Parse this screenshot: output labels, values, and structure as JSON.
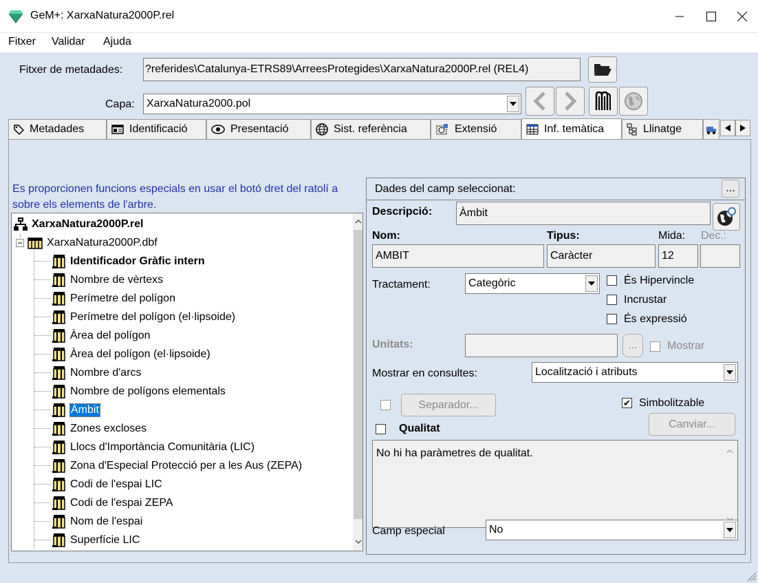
{
  "window": {
    "title": "GeM+: XarxaNatura2000P.rel"
  },
  "menu": [
    "Fitxer",
    "Validar",
    "Ajuda"
  ],
  "form": {
    "file_label": "Fitxer de metadades:",
    "file_value": "?referides\\Catalunya-ETRS89\\ArreesProtegides\\XarxaNatura2000P.rel (REL4)",
    "layer_label": "Capa:",
    "layer_value": "XarxaNatura2000.pol"
  },
  "tabs": [
    "Metadades",
    "Identificació",
    "Presentació",
    "Sist. referència",
    "Extensió",
    "Inf. temàtica",
    "Llinatge"
  ],
  "tree": {
    "hint": "Es proporcionen funcions especials en usar el botó dret del ratolí a sobre els elements de l'arbre.",
    "root": "XarxaNatura2000P.rel",
    "table": "XarxaNatura2000P.dbf",
    "fields": [
      "Identificador Gràfic intern",
      "Nombre de vèrtexs",
      "Perímetre del polígon",
      "Perímetre del polígon (el·lipsoide)",
      "Àrea del polígon",
      "Àrea del polígon (el·lipsoide)",
      "Nombre d'arcs",
      "Nombre de polígons elementals",
      "Àmbit",
      "Zones excloses",
      "Llocs d'Importància Comunitària (LIC)",
      "Zona d'Especial Protecció per a les Aus (ZEPA)",
      "Codi de l'espai LIC",
      "Codi de l'espai ZEPA",
      "Nom de l'espai",
      "Superfície LIC"
    ]
  },
  "detail": {
    "header": "Dades del camp seleccionat:",
    "header_btn": "...",
    "desc_label": "Descripció:",
    "desc_value": "Àmbit",
    "nom_label": "Nom:",
    "nom_value": "AMBIT",
    "tipus_label": "Tipus:",
    "tipus_value": "Caràcter",
    "mida_label": "Mida:",
    "mida_value": "12",
    "dec_label": "Dec.:",
    "dec_value": "",
    "tractament_label": "Tractament:",
    "tractament_value": "Categòric",
    "hipervincle_label": "És Hipervincle",
    "incrustar_label": "Incrustar",
    "expressio_label": "És expressió",
    "unitats_label": "Unitats:",
    "unitats_btn": "...",
    "mostrar_label": "Mostrar",
    "consultes_label": "Mostrar en consultes:",
    "consultes_value": "Localització i atributs",
    "separador_btn": "Separador...",
    "simbolitzable_label": "Simbolitzable",
    "qualitat_label": "Qualitat",
    "canviar_btn": "Canviar...",
    "qualitat_text": "No hi ha paràmetres de qualitat.",
    "camp_especial_label": "Camp especial",
    "camp_especial_value": "No"
  }
}
